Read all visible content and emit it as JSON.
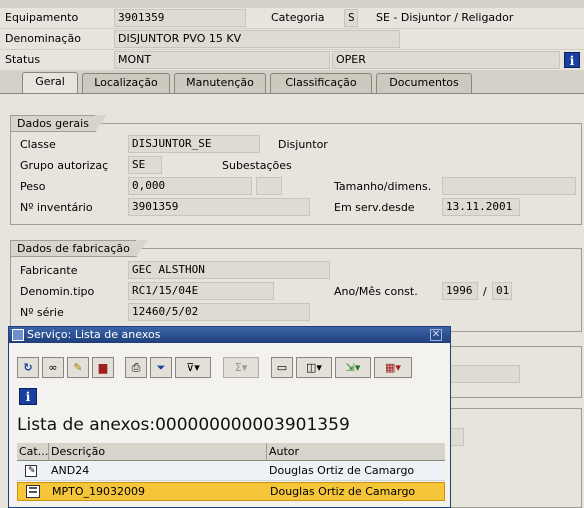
{
  "header": {
    "equipamento_label": "Equipamento",
    "equipamento_value": "3901359",
    "categoria_label": "Categoria",
    "categoria_value": "S",
    "categoria_desc": "SE - Disjuntor / Religador",
    "denominacao_label": "Denominação",
    "denominacao_value": "DISJUNTOR PVO 15 KV",
    "status_label": "Status",
    "status_value": "MONT",
    "status_value2": "OPER",
    "info_icon": "i"
  },
  "tabs": [
    {
      "label": "Geral"
    },
    {
      "label": "Localização"
    },
    {
      "label": "Manutenção"
    },
    {
      "label": "Classificação"
    },
    {
      "label": "Documentos"
    }
  ],
  "dados_gerais": {
    "title": "Dados gerais",
    "classe_label": "Classe",
    "classe_value": "DISJUNTOR_SE",
    "classe_desc": "Disjuntor",
    "grupo_label": "Grupo autorizaç",
    "grupo_value": "SE",
    "grupo_desc": "Subestações",
    "peso_label": "Peso",
    "peso_value": "0,000",
    "tamanho_label": "Tamanho/dimens.",
    "inventario_label": "Nº inventário",
    "inventario_value": "3901359",
    "emserv_label": "Em serv.desde",
    "emserv_value": "13.11.2001"
  },
  "dados_fabricacao": {
    "title": "Dados de fabricação",
    "fabricante_label": "Fabricante",
    "fabricante_value": "GEC ALSTHON",
    "denomin_label": "Denomin.tipo",
    "denomin_value": "RC1/15/04E",
    "anomes_label": "Ano/Mês const.",
    "ano_value": "1996",
    "sep": "/",
    "mes_value": "01",
    "serie_label": "Nº série",
    "serie_value": "12460/5/02"
  },
  "dialog": {
    "title": "Serviço: Lista de anexos",
    "heading": "Lista de anexos:000000000003901359",
    "columns": {
      "cat": "Cat...",
      "descricao": "Descrição",
      "autor": "Autor"
    },
    "rows": [
      {
        "descricao": "AND24",
        "autor": "Douglas Ortiz de Camargo",
        "icon": "note-icon"
      },
      {
        "descricao": "MPTO_19032009",
        "autor": "Douglas Ortiz de Camargo",
        "icon": "document-icon"
      }
    ],
    "info_icon": "i"
  },
  "colors": {
    "selected_row": "#f6c63a",
    "title_bar": "#1f3f7a",
    "row_alt": "#eef2f6"
  }
}
